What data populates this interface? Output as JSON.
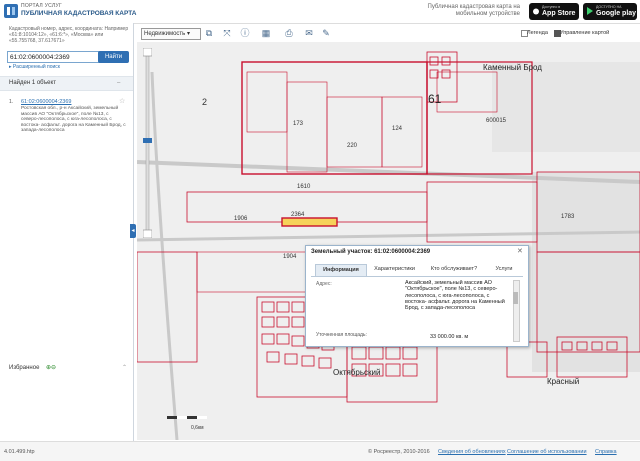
{
  "header": {
    "portal_label": "ПОРТАЛ УСЛУГ",
    "site_title": "ПУБЛИЧНАЯ КАДАСТРОВАЯ КАРТА",
    "promo_text": "Публичная кадастровая карта на мобильном устройстве",
    "appstore_small": "Доступно в",
    "appstore_big": "App Store",
    "gplay_small": "ДОСТУПНО НА",
    "gplay_big": "Google play"
  },
  "search": {
    "hint": "Кадастровый номер, адрес, координата: Например «61:8:10104:12», «61:6:*», «Москва» или «55.755768, 37.617671»",
    "value": "61:02:0600004:2369",
    "find_label": "Найти",
    "advanced_label": "Расширенный поиск"
  },
  "results": {
    "count_label": "Найден 1 объект",
    "items": [
      {
        "num": "1.",
        "link": "61:02:0600004:2369",
        "desc": "Ростовская обл., р-н Аксайский, земельный массив АО \"Октябрьское\", поле №13, с северо-лесополоса, с юга-лесополоса, с востока- асфальт. дорога на Каменный Брод, с запада-лесополоса"
      }
    ]
  },
  "favorites": {
    "label": "Избранное"
  },
  "toolbar": {
    "layer_select": "Недвижимость",
    "legend_label": "Легенда",
    "basemap_label": "Управление картой",
    "tools": [
      "layers-icon",
      "measure-icon",
      "identify-icon",
      "select-area-icon",
      "print-icon",
      "share-icon",
      "ruler-icon"
    ]
  },
  "map": {
    "labels": {
      "kamenny_brod": "Каменный Брод",
      "oktyabrsky": "Октябрьский",
      "krasny": "Красный",
      "n61": "61",
      "n600015": "600015",
      "n2": "2",
      "n1610": "1610",
      "n2364": "2364",
      "n1904": "1904",
      "n1783": "1783",
      "n220": "220",
      "n173": "173",
      "n124": "124",
      "n1906": "1906"
    },
    "scale_label": "0,6км"
  },
  "popup": {
    "title": "Земельный участок: 61:02:0600004:2369",
    "tabs": [
      "Информация",
      "Характеристики",
      "Кто обслуживает?",
      "Услуги"
    ],
    "active_tab": "Информация",
    "address_label": "Адрес:",
    "address": "Аксайский, земельный массив АО \"Октябрьское\", поле №13, с северо-лесополоса, с юга-лесополоса, с востока- асфальт. дорога на Каменный Брод, с запада-лесополоса",
    "area_label": "Уточненная площадь:",
    "area_value": "33 000.00 кв. м"
  },
  "footer": {
    "version": "4.01.499.htp",
    "copyright": "© Росреестр, 2010-2016",
    "links": [
      "Сведения об обновлениях",
      "Соглашение об использовании",
      "Справка"
    ]
  },
  "colors": {
    "accent": "#2f6fb3",
    "parcel_border": "#c8102e",
    "popup_border": "#9bb4cc"
  }
}
